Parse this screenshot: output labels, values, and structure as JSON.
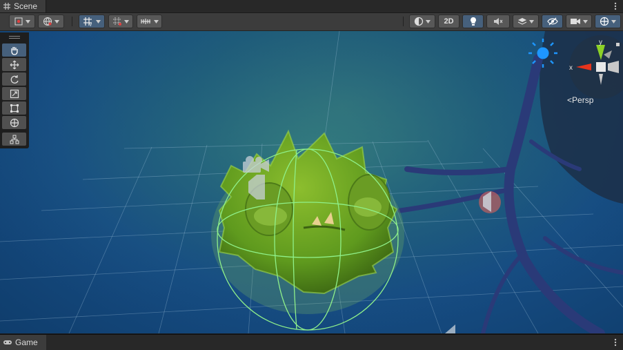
{
  "scene_tab": {
    "label": "Scene",
    "icon": "hash-grid-icon"
  },
  "game_tab": {
    "label": "Game",
    "icon": "gamepad-icon"
  },
  "toolbar": {
    "btn_2d": "2D",
    "left_buttons": [
      "draw-mode",
      "global-toggle",
      "grid-snap",
      "grid-toggle",
      "increment-snap"
    ],
    "right_buttons": [
      "shading-mode",
      "2d-toggle",
      "lighting-toggle",
      "audio-toggle",
      "effects-toggle",
      "visibility-toggle",
      "camera-settings",
      "gizmos"
    ]
  },
  "tools": [
    "hand",
    "move",
    "rotate",
    "scale",
    "rect",
    "transform",
    "custom"
  ],
  "gizmo": {
    "y_label": "y",
    "x_label": "x",
    "projection": "Persp"
  },
  "colors": {
    "panel": "#3c3c3c",
    "active": "#46607c",
    "gizmo_y": "#8cd126",
    "gizmo_x": "#e6341c",
    "selection": "#8ff08a"
  }
}
